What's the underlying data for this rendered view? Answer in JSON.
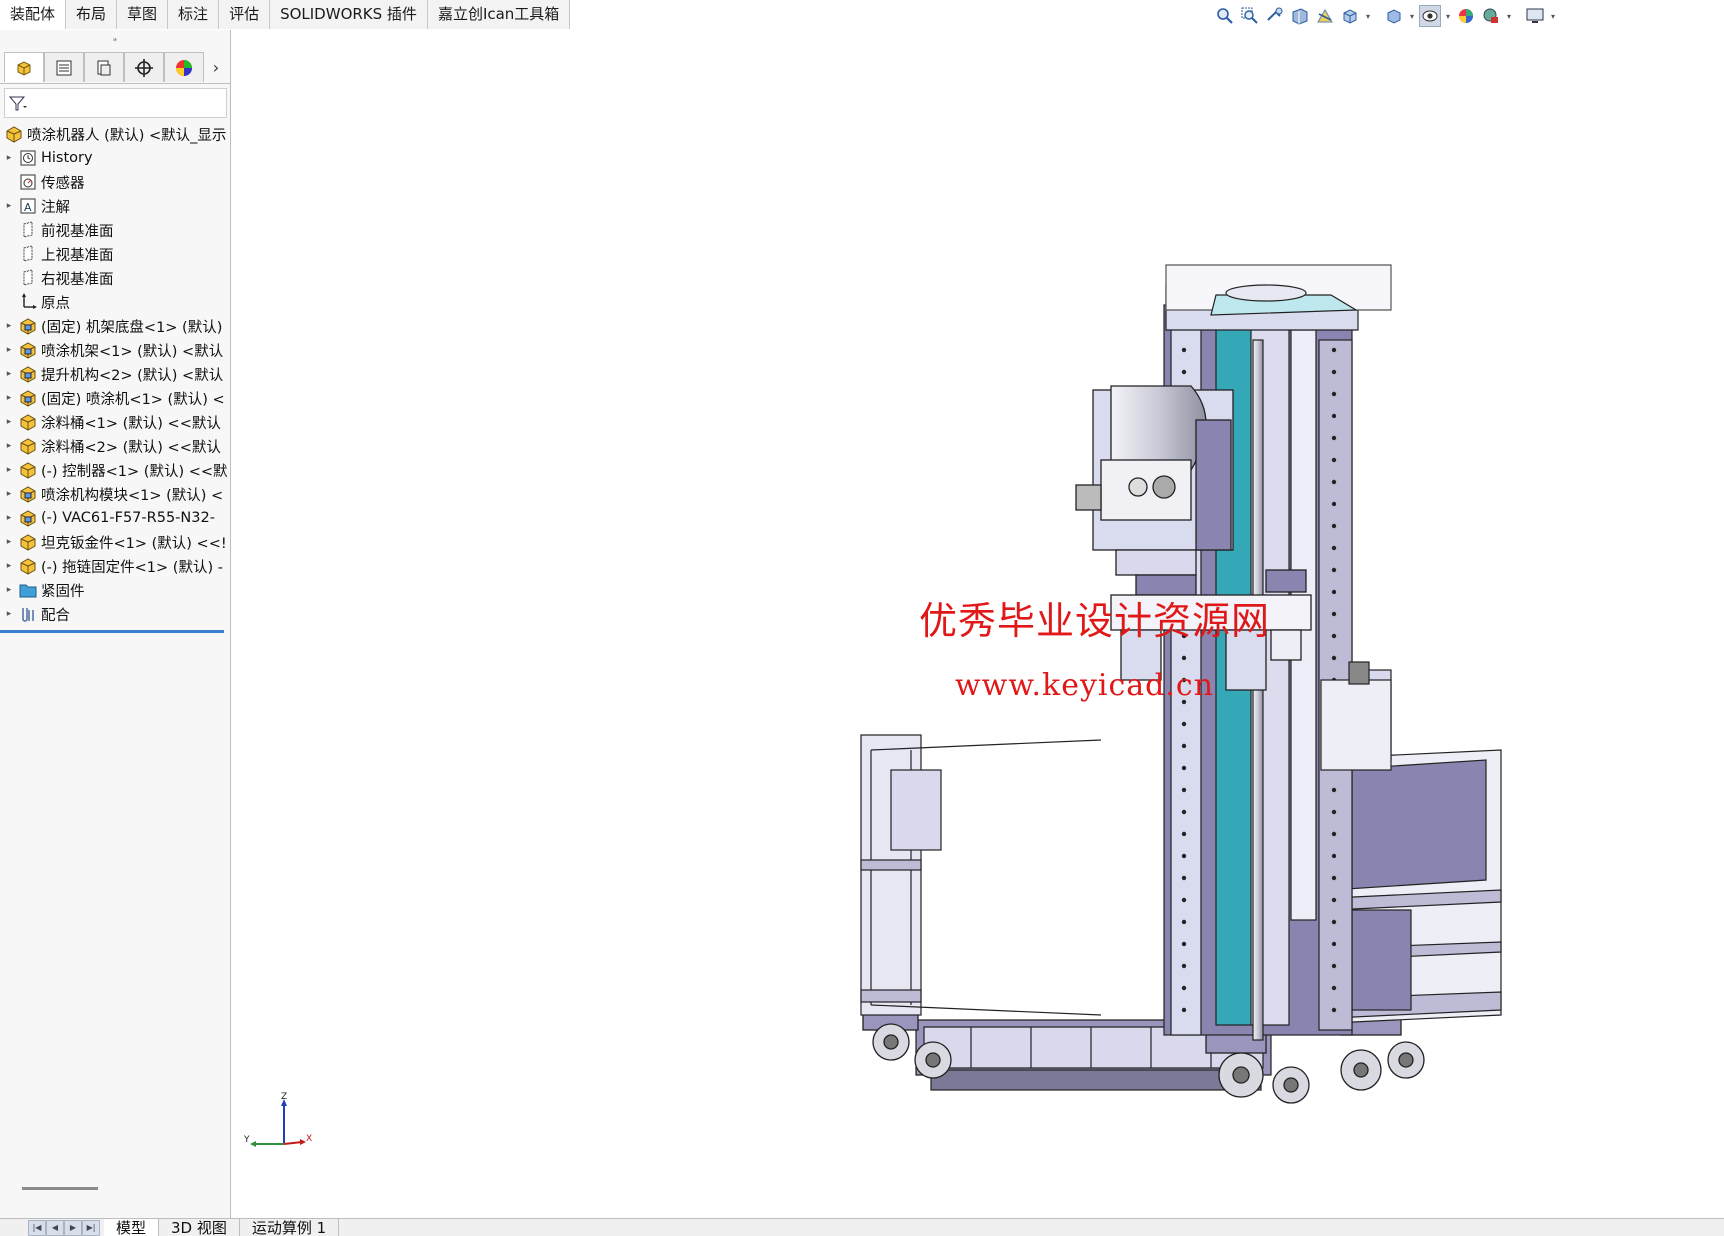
{
  "command_tabs": [
    {
      "label": "装配体",
      "active": true
    },
    {
      "label": "布局"
    },
    {
      "label": "草图"
    },
    {
      "label": "标注"
    },
    {
      "label": "评估"
    },
    {
      "label": "SOLIDWORKS 插件"
    },
    {
      "label": "嘉立创Ican工具箱"
    }
  ],
  "hud_icons": [
    "zoom-to-fit-icon",
    "zoom-to-area-icon",
    "previous-view-icon",
    "section-view-icon",
    "dynamic-annotation-icon",
    "view-orientation-icon",
    "display-style-icon",
    "hide-show-items-icon",
    "edit-appearance-icon",
    "apply-scene-icon",
    "view-settings-icon"
  ],
  "feature_manager": {
    "tabs": [
      "featuremanager-tab",
      "propertymanager-tab",
      "configurationmanager-tab",
      "dimxpert-tab",
      "display-manager-tab"
    ],
    "root": "喷涂机器人 (默认) <默认_显示",
    "nodes": [
      {
        "label": "History",
        "icon": "history-icon",
        "expandable": true
      },
      {
        "label": "传感器",
        "icon": "sensor-icon",
        "expandable": false
      },
      {
        "label": "注解",
        "icon": "annotation-icon",
        "expandable": true
      },
      {
        "label": "前视基准面",
        "icon": "plane-icon",
        "expandable": false
      },
      {
        "label": "上视基准面",
        "icon": "plane-icon",
        "expandable": false
      },
      {
        "label": "右视基准面",
        "icon": "plane-icon",
        "expandable": false
      },
      {
        "label": "原点",
        "icon": "origin-icon",
        "expandable": false
      },
      {
        "label": "(固定) 机架底盘<1> (默认)",
        "icon": "assembly-icon",
        "expandable": true
      },
      {
        "label": "喷涂机架<1> (默认) <默认",
        "icon": "assembly-icon",
        "expandable": true
      },
      {
        "label": "提升机构<2> (默认) <默认",
        "icon": "assembly-icon",
        "expandable": true
      },
      {
        "label": "(固定) 喷涂机<1> (默认) <",
        "icon": "assembly-icon",
        "expandable": true
      },
      {
        "label": "涂料桶<1> (默认) <<默认",
        "icon": "part-icon",
        "expandable": true
      },
      {
        "label": "涂料桶<2> (默认) <<默认",
        "icon": "part-icon",
        "expandable": true
      },
      {
        "label": "(-) 控制器<1> (默认) <<默",
        "icon": "part-icon",
        "expandable": true
      },
      {
        "label": "喷涂机构模块<1> (默认) <",
        "icon": "assembly-icon",
        "expandable": true
      },
      {
        "label": "(-) VAC61-F57-R55-N32-",
        "icon": "assembly-icon",
        "expandable": true
      },
      {
        "label": "坦克钣金件<1> (默认) <<!",
        "icon": "part-icon",
        "expandable": true
      },
      {
        "label": "(-) 拖链固定件<1> (默认) -",
        "icon": "part-icon",
        "expandable": true
      },
      {
        "label": "紧固件",
        "icon": "folder-icon",
        "expandable": true
      },
      {
        "label": "配合",
        "icon": "mates-icon",
        "expandable": true
      }
    ]
  },
  "bottom_tabs": [
    {
      "label": "模型",
      "active": true
    },
    {
      "label": "3D 视图"
    },
    {
      "label": "运动算例 1"
    }
  ],
  "watermark": {
    "line1": "优秀毕业设计资源网",
    "line2": "www.keyicad.cn"
  },
  "triad": {
    "x": "X",
    "y": "Y",
    "z": "Z"
  },
  "colors": {
    "frame_purple": "#8a84b0",
    "frame_light": "#d9dbef",
    "teal": "#35a8b8",
    "watermark_red": "#e01818"
  }
}
